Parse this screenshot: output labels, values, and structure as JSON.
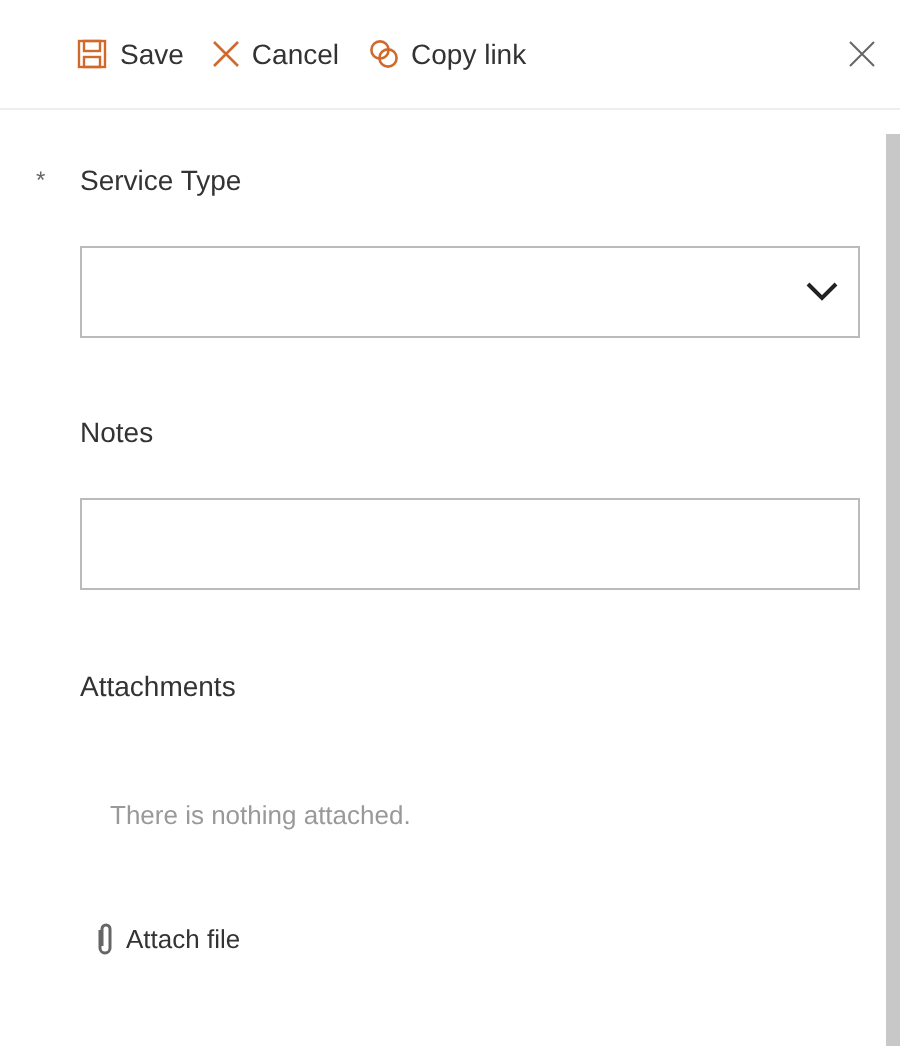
{
  "toolbar": {
    "actions": [
      {
        "kind": "save",
        "label": "Save"
      },
      {
        "kind": "cancel",
        "label": "Cancel"
      },
      {
        "kind": "link",
        "label": "Copy link"
      }
    ]
  },
  "fields": [
    {
      "kind": "dropdown",
      "label": "Service Type",
      "required_mark": "*"
    },
    {
      "kind": "text",
      "label": "Notes"
    }
  ],
  "attachments": {
    "label": "Attachments",
    "empty_message": "There is nothing attached.",
    "attach_label": "Attach file"
  }
}
